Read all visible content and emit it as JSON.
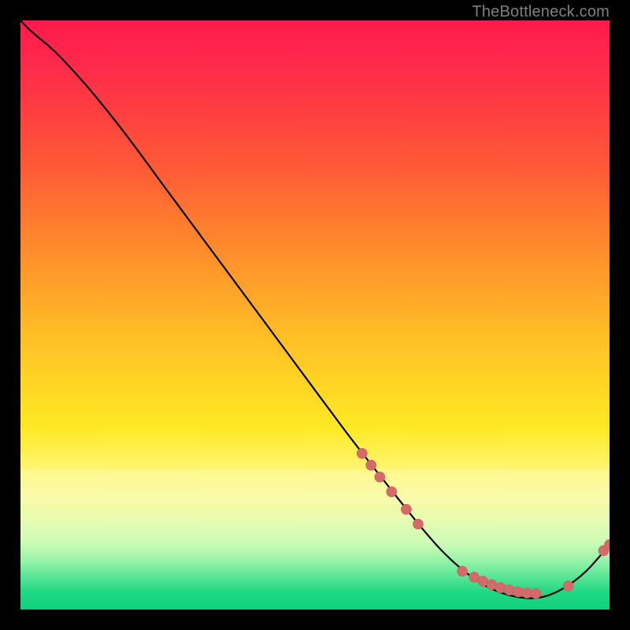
{
  "watermark": "TheBottleneck.com",
  "colors": {
    "marker": "#d46a6a",
    "curve": "#000000"
  },
  "chart_data": {
    "type": "line",
    "title": "",
    "xlabel": "",
    "ylabel": "",
    "xlim": [
      0,
      100
    ],
    "ylim": [
      0,
      100
    ],
    "grid": false,
    "legend": false,
    "series": [
      {
        "name": "curve",
        "x": [
          0,
          2,
          5,
          8,
          12,
          18,
          25,
          35,
          45,
          55,
          62,
          68,
          72,
          76,
          80,
          84,
          88,
          92,
          96,
          100
        ],
        "y": [
          100,
          98,
          95.5,
          92.5,
          88,
          80.5,
          71,
          57.5,
          44,
          30.5,
          21.5,
          14,
          9.5,
          6,
          3.5,
          2.2,
          2,
          3.5,
          6.5,
          11
        ]
      }
    ],
    "markers": [
      {
        "x": 58,
        "y": 26.5
      },
      {
        "x": 59.5,
        "y": 24.5
      },
      {
        "x": 61,
        "y": 22.5
      },
      {
        "x": 63,
        "y": 20
      },
      {
        "x": 65.5,
        "y": 17
      },
      {
        "x": 67.5,
        "y": 14.5
      },
      {
        "x": 75,
        "y": 6.5
      },
      {
        "x": 77,
        "y": 5.5
      },
      {
        "x": 78.5,
        "y": 4.8
      },
      {
        "x": 80,
        "y": 4.2
      },
      {
        "x": 81.5,
        "y": 3.7
      },
      {
        "x": 83,
        "y": 3.3
      },
      {
        "x": 84.5,
        "y": 3.0
      },
      {
        "x": 86,
        "y": 2.8
      },
      {
        "x": 87.5,
        "y": 2.7
      },
      {
        "x": 93,
        "y": 4.0
      },
      {
        "x": 99,
        "y": 10.0
      },
      {
        "x": 100,
        "y": 11.0
      }
    ]
  }
}
